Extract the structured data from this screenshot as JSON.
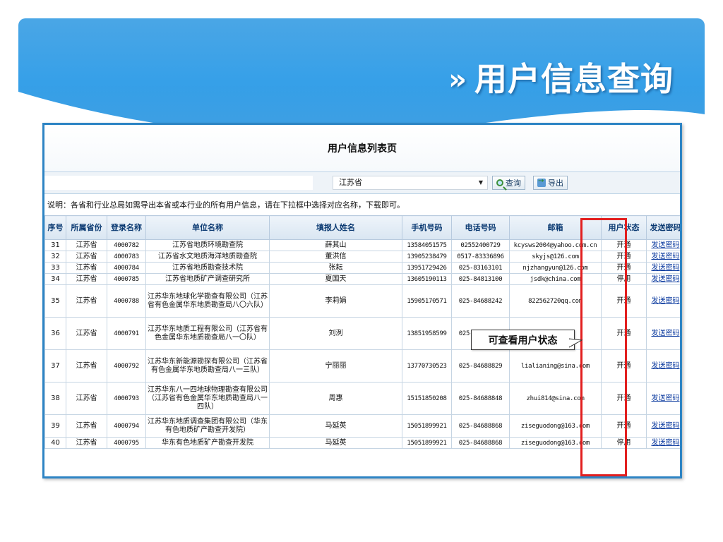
{
  "slide": {
    "title": "用户信息查询",
    "title_chevron": "»"
  },
  "panel": {
    "title": "用户信息列表页",
    "filter": {
      "selected_province": "江苏省",
      "query_button": "查询",
      "export_button": "导出"
    },
    "note": "说明：各省和行业总局如需导出本省或本行业的所有用户信息，请在下拉框中选择对应名称，下载即可。"
  },
  "table": {
    "headers": [
      "序号",
      "所属省份",
      "登录名称",
      "单位名称",
      "填报人姓名",
      "手机号码",
      "电话号码",
      "邮箱",
      "用户状态",
      "发送密码"
    ],
    "rows": [
      {
        "no": "31",
        "province": "江苏省",
        "login": "4000782",
        "unit": "江苏省地质环境勘查院",
        "person": "薛其山",
        "mobile": "13584051575",
        "phone": "02552400729",
        "email": "kcysws2004@yahoo.com.cn",
        "status": "开通",
        "action": "发送密码"
      },
      {
        "no": "32",
        "province": "江苏省",
        "login": "4000783",
        "unit": "江苏省水文地质海洋地质勘查院",
        "person": "董洪信",
        "mobile": "13905238479",
        "phone": "0517-83336896",
        "email": "skyjs@126.com",
        "status": "开通",
        "action": "发送密码"
      },
      {
        "no": "33",
        "province": "江苏省",
        "login": "4000784",
        "unit": "江苏省地质勘查技术院",
        "person": "张耘",
        "mobile": "13951729426",
        "phone": "025-83163101",
        "email": "njzhangyun@126.com",
        "status": "开通",
        "action": "发送密码"
      },
      {
        "no": "34",
        "province": "江苏省",
        "login": "4000785",
        "unit": "江苏省地质矿产调查研究所",
        "person": "夏国天",
        "mobile": "13605190113",
        "phone": "025-84813100",
        "email": "jsdk@china.com",
        "status": "停用",
        "action": "发送密码"
      },
      {
        "no": "35",
        "province": "江苏省",
        "login": "4000788",
        "unit": "江苏华东地球化学勘查有限公司（江苏省有色金属华东地质勘查局八〇六队）",
        "person": "李莉娟",
        "mobile": "15905170571",
        "phone": "025-84688242",
        "email": "822562720qq.com",
        "status": "开通",
        "action": "发送密码"
      },
      {
        "no": "36",
        "province": "江苏省",
        "login": "4000791",
        "unit": "江苏华东地质工程有限公司（江苏省有色金属华东地质勘查局八一〇队）",
        "person": "刘洌",
        "mobile": "13851958599",
        "phone": "025-85778933",
        "email": "...@...",
        "status": "开通",
        "action": "发送密码"
      },
      {
        "no": "37",
        "province": "江苏省",
        "login": "4000792",
        "unit": "江苏华东新能源勘探有限公司（江苏省有色金属华东地质勘查局八一三队）",
        "person": "宁丽丽",
        "mobile": "13770730523",
        "phone": "025-84688829",
        "email": "lialianing@sina.com",
        "status": "开通",
        "action": "发送密码"
      },
      {
        "no": "38",
        "province": "江苏省",
        "login": "4000793",
        "unit": "江苏华东八一四地球物理勘查有限公司（江苏省有色金属华东地质勘查局八一四队）",
        "person": "周惠",
        "mobile": "15151850208",
        "phone": "025-84688848",
        "email": "zhui814@sina.com",
        "status": "开通",
        "action": "发送密码"
      },
      {
        "no": "39",
        "province": "江苏省",
        "login": "4000794",
        "unit": "江苏华东地质调查集团有限公司（华东有色地质矿产勘查开发院）",
        "person": "马延英",
        "mobile": "15051899921",
        "phone": "025-84688868",
        "email": "ziseguodong@163.com",
        "status": "开通",
        "action": "发送密码"
      },
      {
        "no": "40",
        "province": "江苏省",
        "login": "4000795",
        "unit": "华东有色地质矿产勘查开发院",
        "person": "马延英",
        "mobile": "15051899921",
        "phone": "025-84688868",
        "email": "ziseguodong@163.com",
        "status": "停用",
        "action": "发送密码"
      }
    ]
  },
  "annotation": {
    "callout_text": "可查看用户状态",
    "highlight_color": "#e21f1f"
  },
  "colors": {
    "banner": "#36a0e8",
    "panel_border": "#2d84c4",
    "header_text": "#0b3a72",
    "link": "#0b3a9f"
  }
}
